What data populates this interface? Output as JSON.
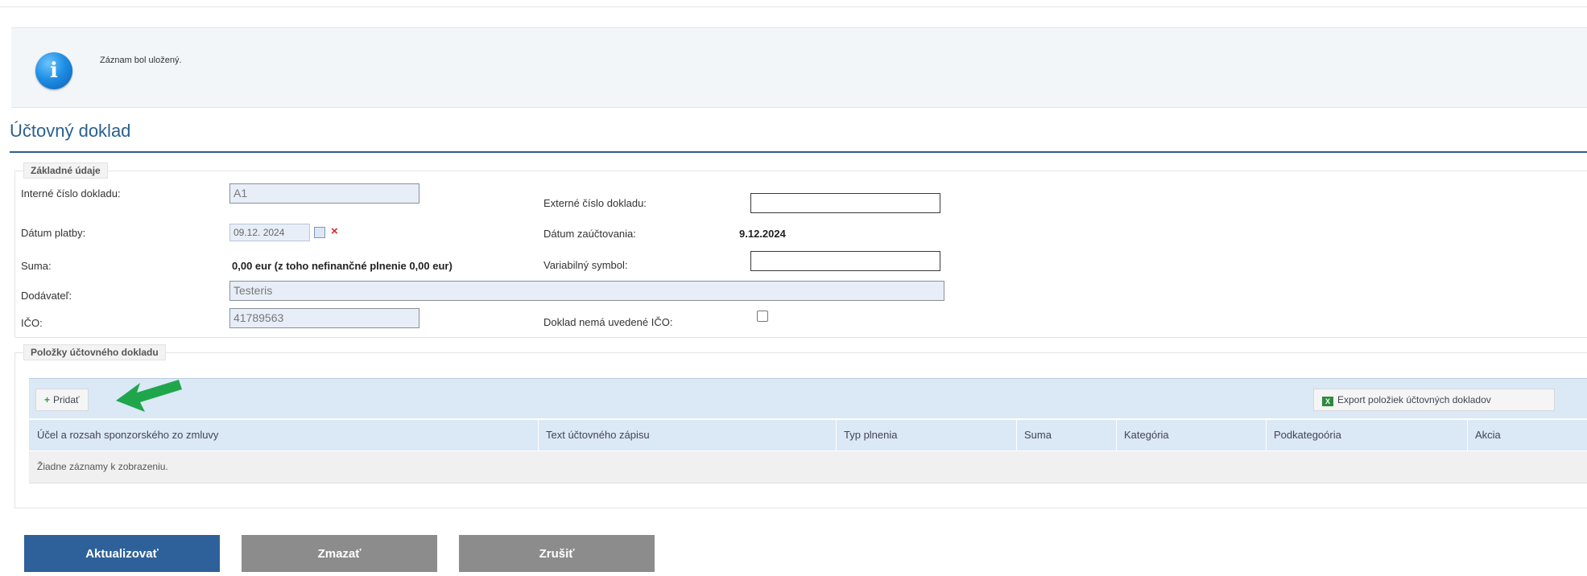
{
  "notification": {
    "text": "Záznam bol uložený."
  },
  "page": {
    "title": "Účtovný doklad"
  },
  "basic": {
    "legend": "Základné údaje",
    "internal_number": {
      "label": "Interné číslo dokladu:",
      "value": "A1"
    },
    "payment_date": {
      "label": "Dátum platby:",
      "value": "09.12. 2024"
    },
    "sum": {
      "label": "Suma:",
      "value": "0,00 eur (z toho nefinančné plnenie 0,00 eur)"
    },
    "supplier": {
      "label": "Dodávateľ:",
      "value": "Testeris"
    },
    "ico": {
      "label": "IČO:",
      "value": "41789563"
    },
    "external_number": {
      "label": "Externé číslo dokladu:",
      "value": ""
    },
    "posting_date": {
      "label": "Dátum zaúčtovania:",
      "value": "9.12.2024"
    },
    "variable_symbol": {
      "label": "Variabilný symbol:",
      "value": ""
    },
    "no_ico": {
      "label": "Doklad nemá uvedené IČO:",
      "checked": false
    }
  },
  "items": {
    "legend": "Položky účtovného dokladu",
    "add_label": "Pridať",
    "export_label": "Export položiek účtovných dokladov",
    "columns": [
      "Účel a rozsah sponzorského zo zmluvy",
      "Text účtovného zápisu",
      "Typ plnenia",
      "Suma",
      "Kategória",
      "Podkategoória",
      "Akcia"
    ],
    "empty_text": "Žiadne záznamy k zobrazeniu."
  },
  "actions": {
    "update": "Aktualizovať",
    "delete": "Zmazať",
    "cancel": "Zrušiť"
  },
  "colors": {
    "primary": "#2e619a",
    "secondary": "#8c8c8c",
    "title": "#2a5f8f",
    "toolbar": "#dbe8f5",
    "arrow": "#1fa64a"
  }
}
